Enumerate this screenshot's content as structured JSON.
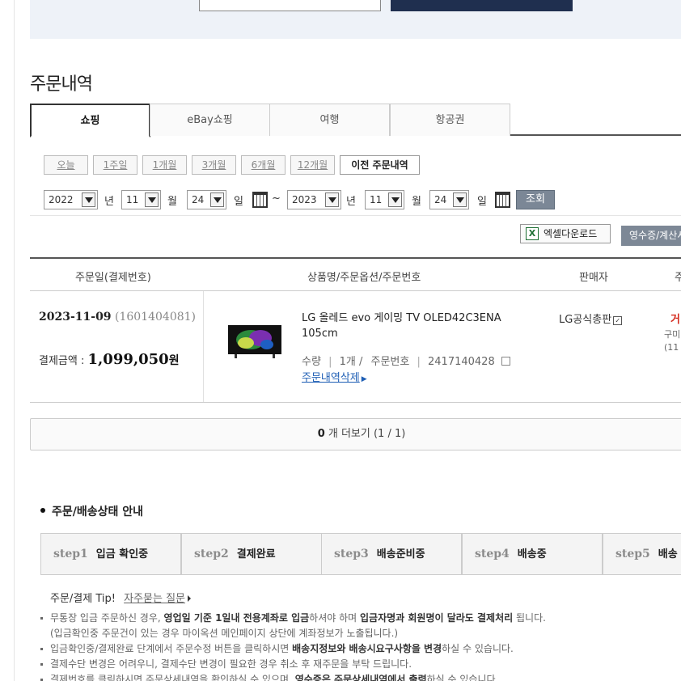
{
  "page": {
    "title": "주문내역"
  },
  "tabs": [
    {
      "label": "쇼핑",
      "active": true
    },
    {
      "label": "eBay쇼핑",
      "active": false
    },
    {
      "label": "여행",
      "active": false
    },
    {
      "label": "항공권",
      "active": false
    }
  ],
  "periods": [
    "오늘",
    "1주일",
    "1개월",
    "3개월",
    "6개월",
    "12개월"
  ],
  "prev_orders_label": "이전 주문내역",
  "date_filter": {
    "from": {
      "year": "2022",
      "month": "11",
      "day": "24"
    },
    "to": {
      "year": "2023",
      "month": "11",
      "day": "24"
    },
    "year_unit": "년",
    "month_unit": "월",
    "day_unit": "일",
    "tilde": "~",
    "search_label": "조회"
  },
  "actions": {
    "excel_label": "엑셀다운로드",
    "excel_icon": "X",
    "receipt_label": "영수증/계산서"
  },
  "table": {
    "headers": [
      "주문일(결제번호)",
      "상품명/주문옵션/주문번호",
      "판매자",
      "주"
    ],
    "order": {
      "date": "2023-11-09",
      "payment_no": "(1601404081)",
      "amount_label": "결제금액 :",
      "amount": "1,099,050",
      "amount_unit": "원",
      "product_name": "LG 올레드 evo 게이밍 TV OLED42C3ENA 105cm",
      "qty_label": "수량",
      "qty": "1개",
      "order_no_label": "주문번호",
      "order_no": "2417140428",
      "cancel_label": "주문내역삭제",
      "seller": "LG공식총판",
      "seller_badge": "✓",
      "status": "거",
      "status_sub1": "구미",
      "status_sub2": "(11"
    }
  },
  "more": {
    "count": "0",
    "text": "개 더보기 (1 / 1)"
  },
  "guide": {
    "title": "주문/배송상태 안내",
    "steps": [
      {
        "num": "step1",
        "label": "입금 확인중"
      },
      {
        "num": "step2",
        "label": "결제완료"
      },
      {
        "num": "step3",
        "label": "배송준비중"
      },
      {
        "num": "step4",
        "label": "배송중"
      },
      {
        "num": "step5",
        "label": "배송"
      }
    ],
    "tip_label": "주문/결제 Tip!",
    "faq_link": "자주묻는 질문",
    "notes": {
      "n1a": "무통장 입금 주문하신 경우,",
      "n1b": "영업일 기준 1일내 전용계좌로 입금",
      "n1c": "하셔야 하며",
      "n1d": "입금자명과 회원명이 달라도 결제처리",
      "n1e": "됩니다.",
      "n1f": "(입금확인중 주문건이 있는 경우 마이옥션 메인페이지 상단에 계좌정보가 노출됩니다.)",
      "n2a": "입금확인중/결제완료 단계에서 주문수정 버튼을 클릭하시면",
      "n2b": "배송지정보와 배송시요구사항을 변경",
      "n2c": "하실 수 있습니다.",
      "n3": "결제수단 변경은 어려우니, 결제수단 변경이 필요한 경우 취소 후 재주문을 부탁 드립니다.",
      "n4a": "결제번호를 클릭하시면 주문상세내역을 확인하실 수 있으며,",
      "n4b": "영수증은 주문상세내역에서 출력",
      "n4c": "하실 수 있습니다."
    }
  }
}
